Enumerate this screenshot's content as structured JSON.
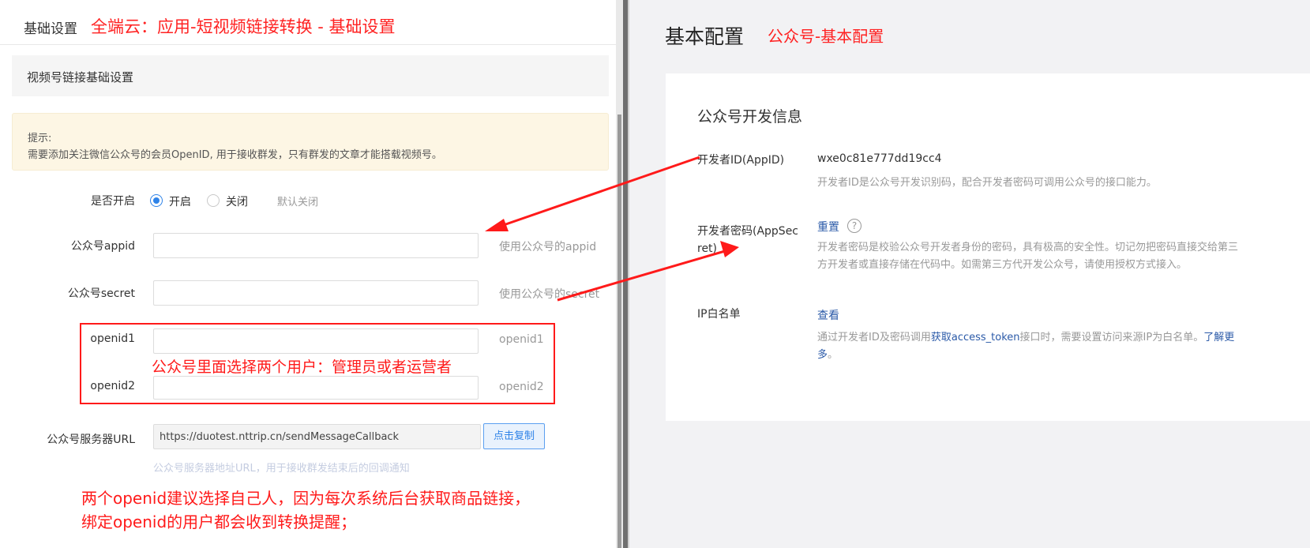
{
  "left": {
    "header_title": "基础设置",
    "annotation_title": "全端云：应用-短视频链接转换 - 基础设置",
    "section_title": "视频号链接基础设置",
    "tip": {
      "label": "提示:",
      "text": "需要添加关注微信公众号的会员OpenID, 用于接收群发，只有群发的文章才能搭载视频号。"
    },
    "enable": {
      "label": "是否开启",
      "option_on": "开启",
      "option_off": "关闭",
      "selected": "开启",
      "hint": "默认关闭"
    },
    "appid": {
      "label": "公众号appid",
      "value": "",
      "hint": "使用公众号的appid"
    },
    "secret": {
      "label": "公众号secret",
      "value": "",
      "hint": "使用公众号的secret"
    },
    "openid1": {
      "label": "openid1",
      "value": "",
      "hint": "openid1"
    },
    "openid2": {
      "label": "openid2",
      "value": "",
      "hint": "openid2"
    },
    "server_url": {
      "label": "公众号服务器URL",
      "value": "https://duotest.nttrip.cn/sendMessageCallback",
      "copy_button": "点击复制",
      "hint": "公众号服务器地址URL，用于接收群发结束后的回调通知"
    },
    "annotation_box": "公众号里面选择两个用户：管理员或者运营者",
    "annotation_bottom_line1": "两个openid建议选择自己人，因为每次系统后台获取商品链接，",
    "annotation_bottom_line2": "绑定openid的用户都会收到转换提醒；"
  },
  "right": {
    "page_title": "基本配置",
    "annotation_title": "公众号-基本配置",
    "card_title": "公众号开发信息",
    "appid": {
      "label": "开发者ID(AppID)",
      "value": "wxe0c81e777dd19cc4",
      "desc": "开发者ID是公众号开发识别码，配合开发者密码可调用公众号的接口能力。"
    },
    "appsecret": {
      "label_line1": "开发者密码(AppSec",
      "label_line2": "ret)",
      "action": "重置",
      "help_icon": "question-circle-icon",
      "desc_line1": "开发者密码是校验公众号开发者身份的密码，具有极高的安全性。切记勿把密码直接交给第三",
      "desc_line2": "方开发者或直接存储在代码中。如需第三方代开发公众号，请使用授权方式接入。"
    },
    "ip_whitelist": {
      "label": "IP白名单",
      "action": "查看",
      "desc_prefix": "通过开发者ID及密码调用",
      "desc_link1": "获取access_token",
      "desc_mid": "接口时，需要设置访问来源IP为白名单。",
      "desc_link2": "了解更",
      "desc_link2_cont": "多",
      "desc_end": "。"
    }
  },
  "colors": {
    "annotation_red": "#ff1a1a",
    "radio_blue": "#2f83e8",
    "link_blue": "#2b5aa8"
  }
}
